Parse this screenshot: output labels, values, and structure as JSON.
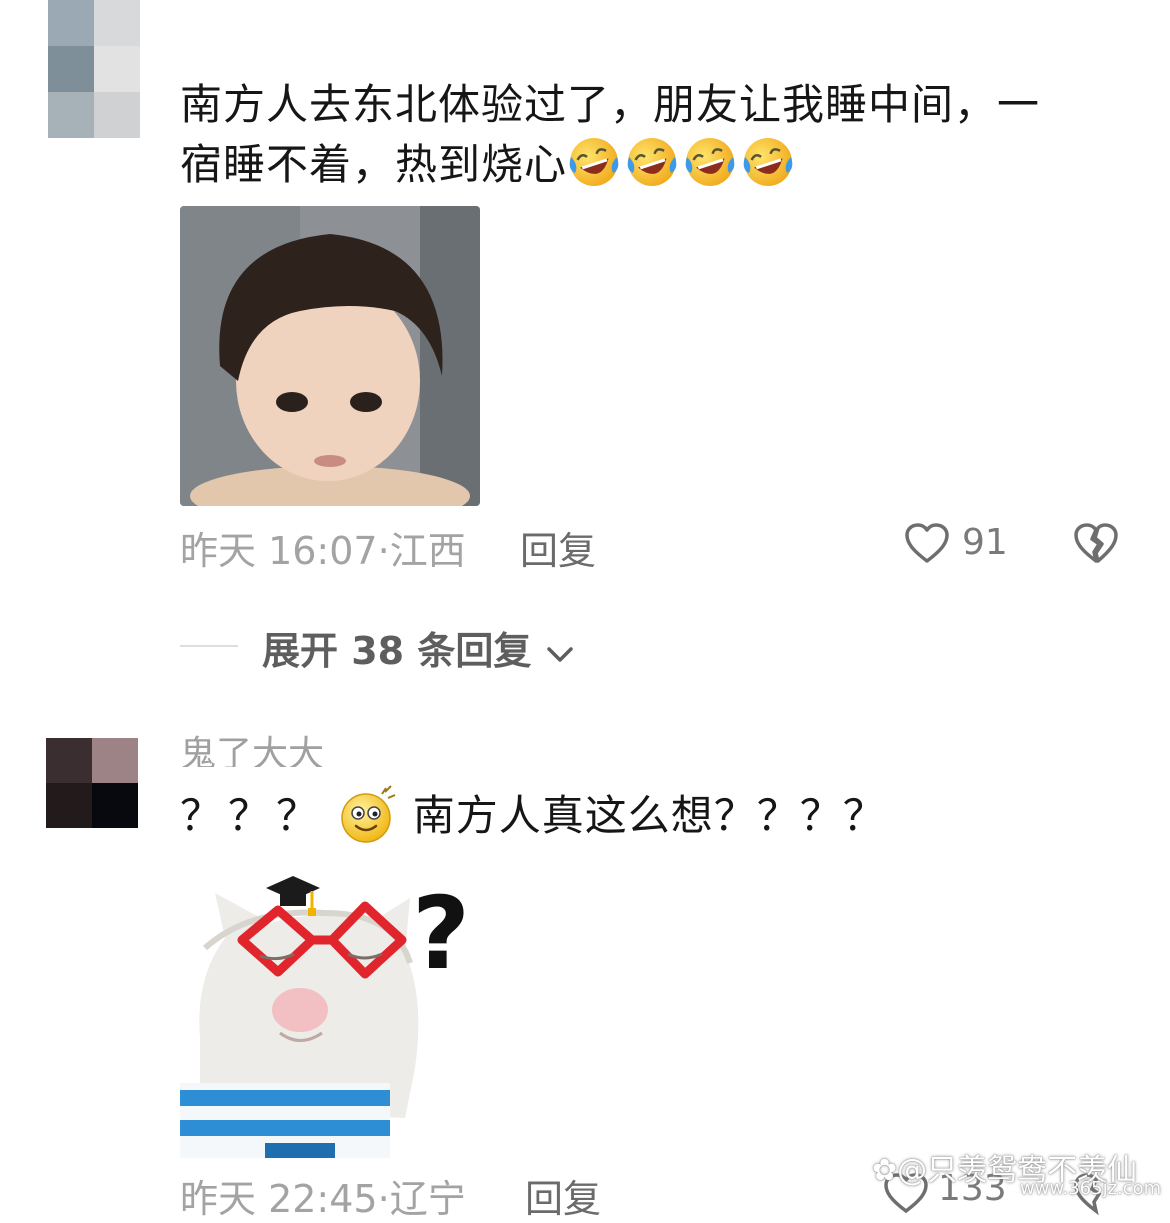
{
  "comments": [
    {
      "text": "南方人去东北体验过了，朋友让我睡中间，一宿睡不着，热到烧心",
      "line1": "南方人去东北体验过了，朋友让我睡中间，一",
      "line2": "宿睡不着，热到烧心",
      "emojis": [
        "rolling-laugh-emoji",
        "rolling-laugh-emoji",
        "rolling-laugh-emoji",
        "rolling-laugh-emoji"
      ],
      "time": "昨天 16:07",
      "location": "江西",
      "reply_label": "回复",
      "likes": "91"
    },
    {
      "username": "鬼了大大",
      "text_pre": "？？？",
      "text_post": "南方人真这么想？？？？",
      "time": "昨天 22:45",
      "location": "辽宁",
      "reply_label": "回复",
      "likes": "133"
    }
  ],
  "expand_replies": "展开 38 条回复",
  "watermark": {
    "handle": "@只羡鸳鸯不羡仙",
    "site": "www.365jz.com"
  },
  "colors": {
    "meta": "#a3a3a3",
    "text": "#161616",
    "reply": "#6b6b6b"
  }
}
